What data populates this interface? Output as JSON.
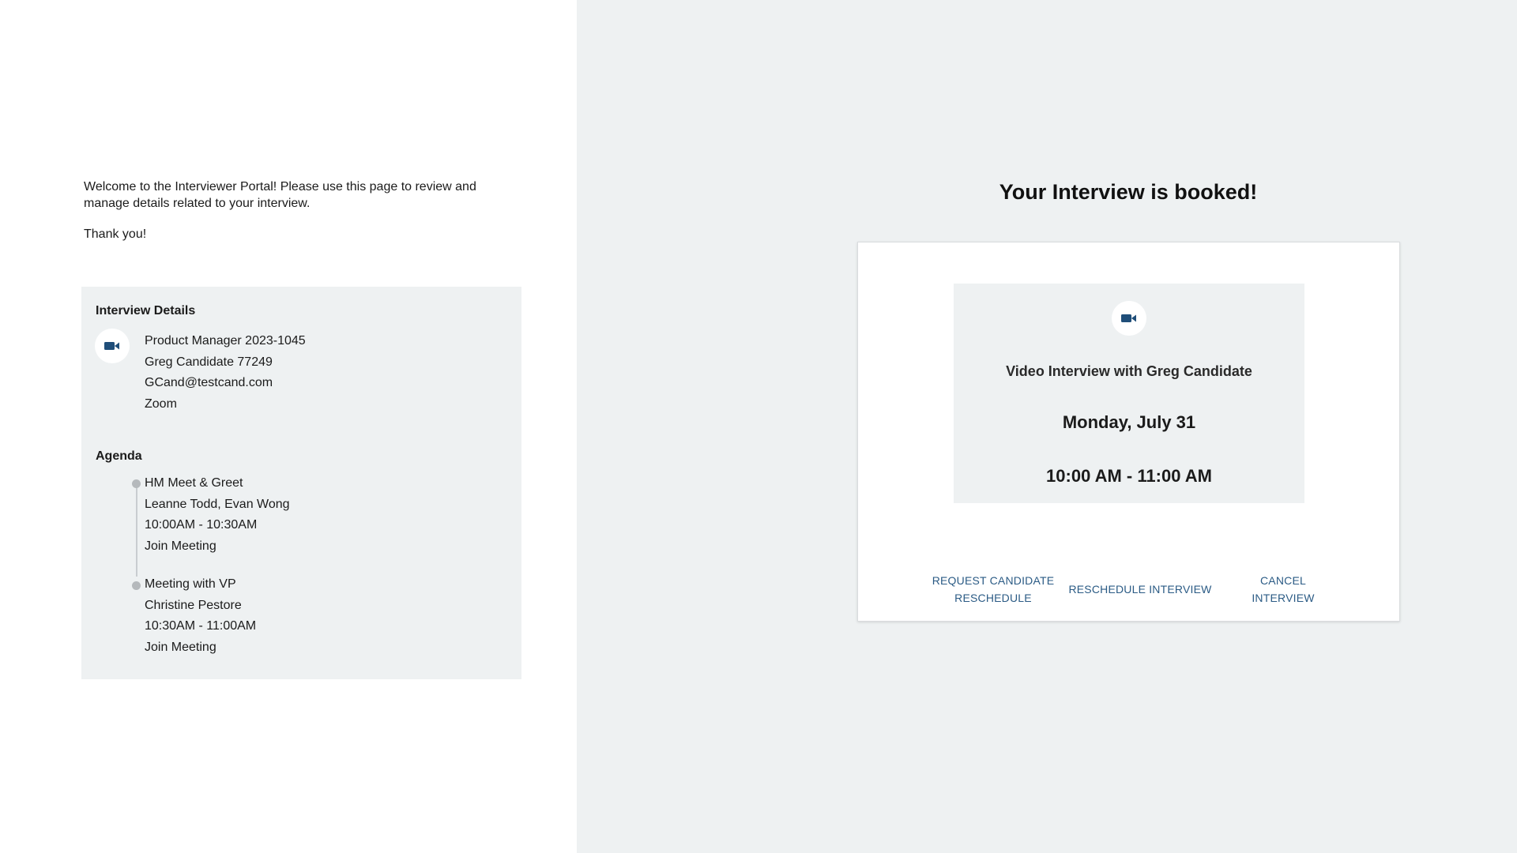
{
  "intro": {
    "welcome_text": "Welcome to the Interviewer Portal! Please use this page to review and manage details related to your interview.",
    "thanks_text": "Thank you!"
  },
  "details": {
    "title": "Interview Details",
    "icon": "video-camera-icon",
    "lines": [
      "Product Manager 2023-1045",
      "Greg Candidate 77249",
      "GCand@testcand.com",
      "Zoom"
    ]
  },
  "agenda": {
    "title": "Agenda",
    "items": [
      {
        "title": "HM Meet & Greet",
        "people": "Leanne Todd, Evan Wong",
        "time": "10:00AM - 10:30AM",
        "link": "Join Meeting"
      },
      {
        "title": "Meeting with VP",
        "people": "Christine Pestore",
        "time": "10:30AM - 11:00AM",
        "link": "Join Meeting"
      }
    ]
  },
  "booking": {
    "title": "Your Interview is booked!",
    "subject": "Video Interview with Greg Candidate",
    "date": "Monday, July 31",
    "time": "10:00 AM - 11:00 AM",
    "icon": "video-camera-icon",
    "actions": {
      "request_line1": "REQUEST CANDIDATE",
      "request_line2": "RESCHEDULE",
      "reschedule": "RESCHEDULE INTERVIEW",
      "cancel_line1": "CANCEL",
      "cancel_line2": "INTERVIEW"
    }
  },
  "colors": {
    "accent": "#1f4e79",
    "panel_bg": "#eef1f2",
    "link": "#2b5b85"
  }
}
